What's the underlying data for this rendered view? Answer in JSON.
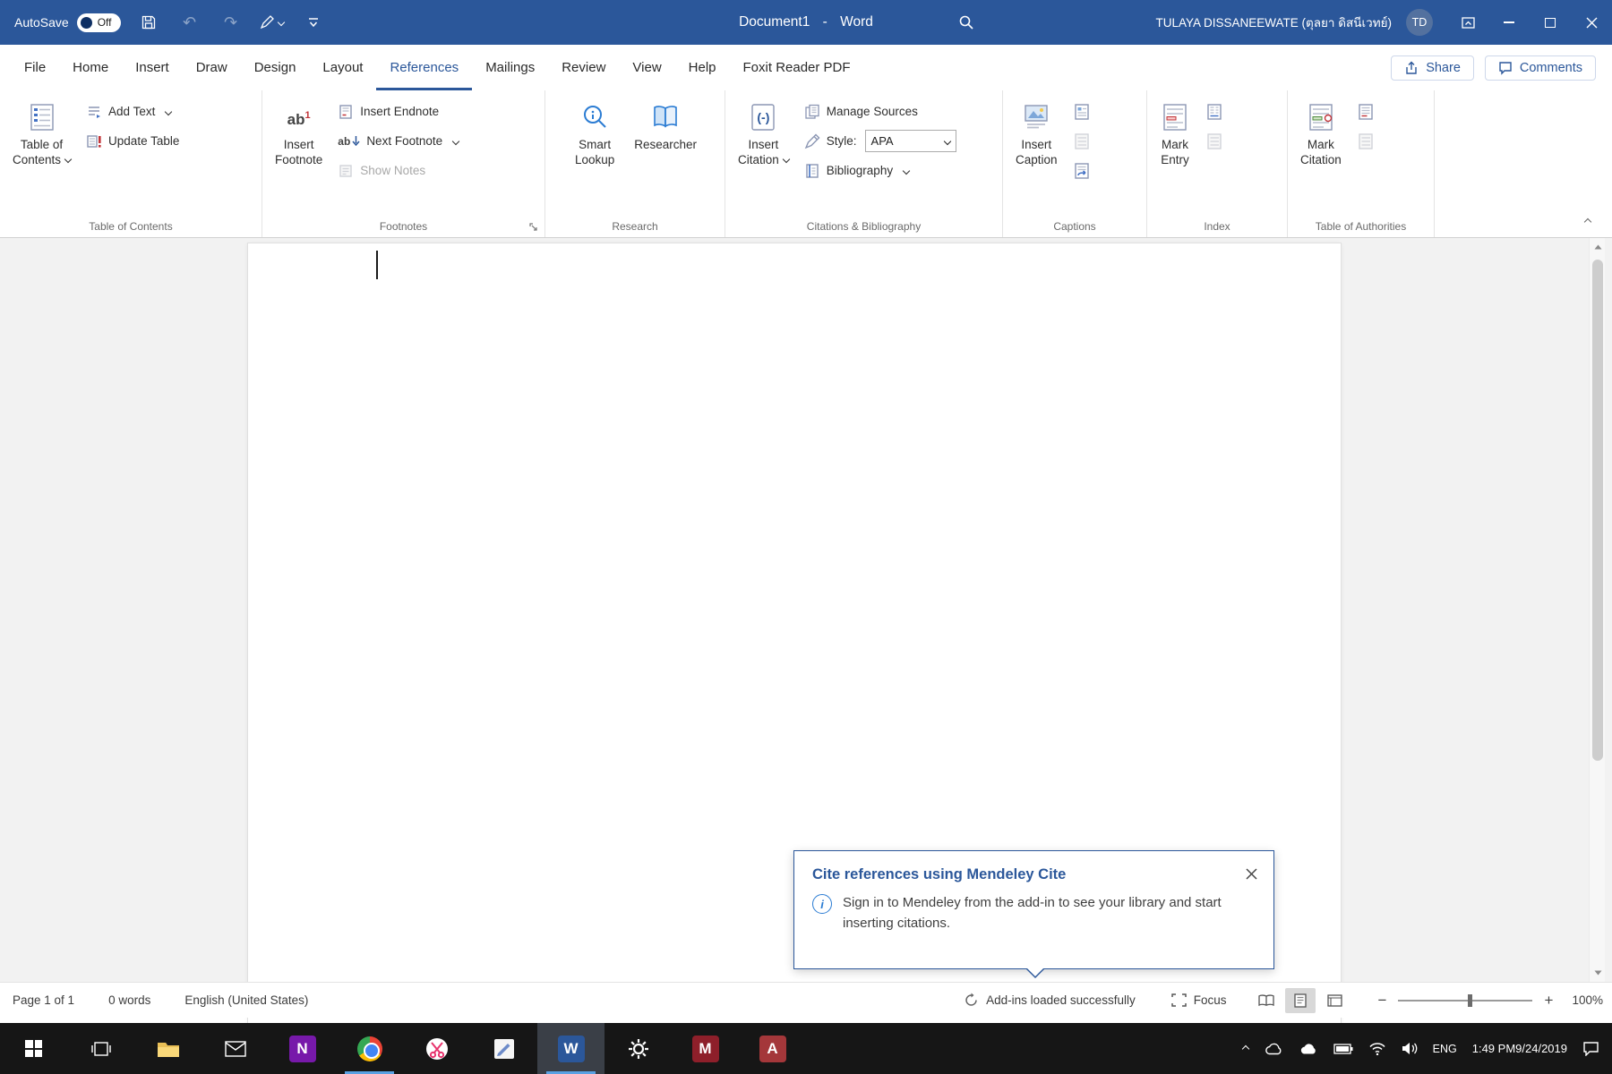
{
  "titlebar": {
    "autosave_label": "AutoSave",
    "autosave_state": "Off",
    "title": "Document1 - Word",
    "user_name": "TULAYA DISSANEEWATE (ตุลยา ดิสนีเวทย์)",
    "avatar_initials": "TD"
  },
  "menubar": {
    "tabs": [
      "File",
      "Home",
      "Insert",
      "Draw",
      "Design",
      "Layout",
      "References",
      "Mailings",
      "Review",
      "View",
      "Help",
      "Foxit Reader PDF"
    ],
    "share_label": "Share",
    "comments_label": "Comments"
  },
  "ribbon": {
    "toc": {
      "big_1": "Table of",
      "big_2": "Contents",
      "add_text": "Add Text",
      "update_table": "Update Table",
      "group_label": "Table of Contents"
    },
    "footnotes": {
      "big_1": "Insert",
      "big_2": "Footnote",
      "insert_endnote": "Insert Endnote",
      "next_footnote": "Next Footnote",
      "show_notes": "Show Notes",
      "group_label": "Footnotes"
    },
    "research": {
      "smart_1": "Smart",
      "smart_2": "Lookup",
      "researcher": "Researcher",
      "group_label": "Research"
    },
    "citations": {
      "big_1": "Insert",
      "big_2": "Citation",
      "manage_sources": "Manage Sources",
      "style_label": "Style:",
      "style_value": "APA",
      "bibliography": "Bibliography",
      "group_label": "Citations & Bibliography"
    },
    "captions": {
      "big_1": "Insert",
      "big_2": "Caption",
      "group_label": "Captions"
    },
    "index": {
      "big_1": "Mark",
      "big_2": "Entry",
      "group_label": "Index"
    },
    "authorities": {
      "big_1": "Mark",
      "big_2": "Citation",
      "group_label": "Table of Authorities"
    }
  },
  "popup": {
    "title": "Cite references using Mendeley Cite",
    "body": "Sign in to Mendeley from the add-in to see your library and start inserting citations.",
    "info_glyph": "i"
  },
  "statusbar": {
    "page_indicator": "Page 1 of 1",
    "word_count": "0 words",
    "language": "English (United States)",
    "addins_status": "Add-ins loaded successfully",
    "focus_label": "Focus",
    "zoom_level": "100%"
  },
  "taskbar": {
    "language": "ENG",
    "time": "1:49 PM",
    "date": "9/24/2019"
  },
  "icons": {
    "undo": "↶",
    "redo": "↷",
    "footnote_ab": "ab",
    "footnote_sup": "1",
    "citation_glyph": "(-)",
    "zoom_out": "−",
    "zoom_in": "+",
    "onenote_letter": "N",
    "word_letter": "W",
    "mendeley_letter": "M",
    "access_letter": "A"
  },
  "colors": {
    "accent": "#2b579a",
    "taskbar_indicator": "#5aa1e3"
  }
}
